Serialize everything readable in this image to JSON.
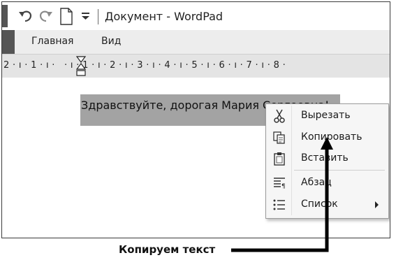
{
  "window": {
    "title": "Документ - WordPad"
  },
  "quick_access": {
    "icons": [
      "undo-icon",
      "redo-icon",
      "new-document-icon",
      "customize-dropdown-icon"
    ]
  },
  "ribbon": {
    "tabs": [
      {
        "label": "Главная"
      },
      {
        "label": "Вид"
      }
    ]
  },
  "ruler": {
    "text": "2 · ı · 1 · ı ·   · ı · 1 · ı · 2 · ı · 3 · ı · 4 · ı · 5 · ı · 6 · ı · 7 · ı · 8 ·"
  },
  "document": {
    "selected_text": "Здравствуйте, дорогая Мария Сергеевна!"
  },
  "context_menu": {
    "items": [
      {
        "label": "Вырезать",
        "icon": "cut-icon"
      },
      {
        "label": "Копировать",
        "icon": "copy-icon"
      },
      {
        "label": "Вставить",
        "icon": "paste-icon"
      },
      {
        "label": "Абзац",
        "icon": "paragraph-icon"
      },
      {
        "label": "Список",
        "icon": "list-icon",
        "has_submenu": true
      }
    ]
  },
  "annotation": {
    "text": "Копируем текст"
  },
  "colors": {
    "selection": "#a3a3a3",
    "ribbon": "#ededed",
    "ruler": "#e4e4e4",
    "menu": "#f6f6f6",
    "arrow": "#000000"
  }
}
